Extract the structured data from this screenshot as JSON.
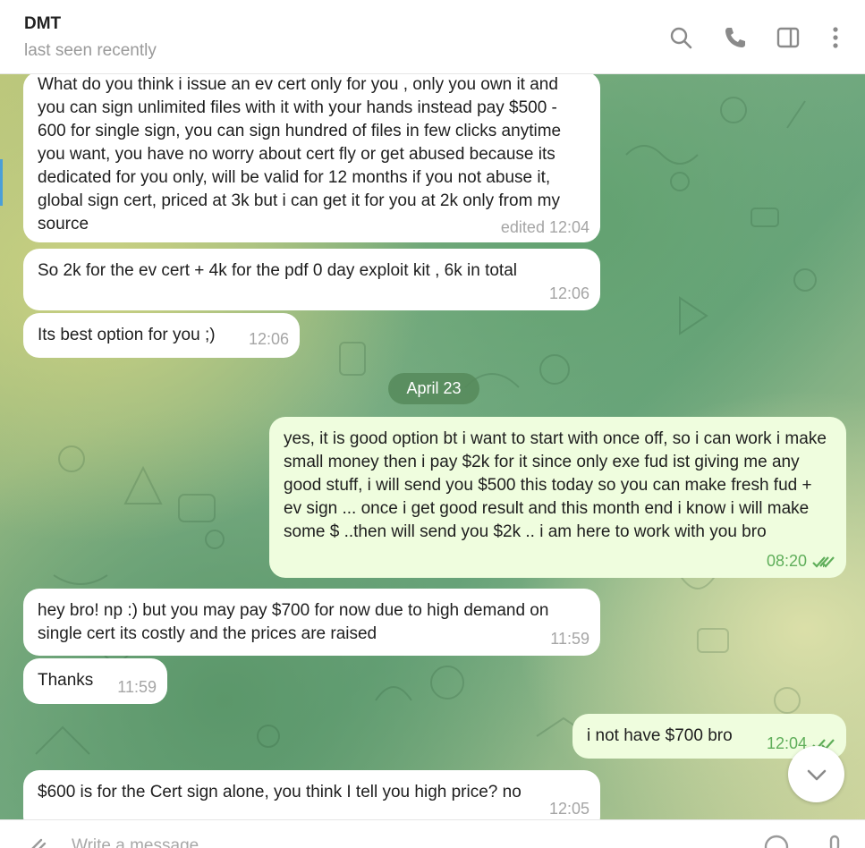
{
  "header": {
    "title": "DMT",
    "status": "last seen recently"
  },
  "date_separator": "April 23",
  "messages": [
    {
      "text": "What do you think i issue an ev cert only for you , only you own it and you can sign unlimited files with it with your hands instead pay $500 - 600 for single sign, you can sign hundred of files in few clicks anytime you want, you have no worry about cert fly or get abused because its dedicated for you only, will be valid for 12 months if you not abuse it, global sign cert, priced at 3k but i can get it for you at 2k only from my source",
      "time": "edited 12:04"
    },
    {
      "text": "So 2k for the ev cert + 4k for the pdf 0 day exploit kit , 6k in total",
      "time": "12:06"
    },
    {
      "text": "Its best option for you ;)",
      "time": "12:06"
    },
    {
      "text": "yes, it is good option bt i want to start with once off, so i can work i make small money then i pay $2k for it since only exe fud ist giving me any good stuff, i will send you $500 this today so you can make fresh fud + ev sign ... once i get good result and this month end i know i will make some $ ..then  will send you $2k .. i am here to work with you bro",
      "time": "08:20"
    },
    {
      "text": "hey bro! np :) but you may pay $700 for now due to high demand on single cert its costly and the prices are raised",
      "time": "11:59"
    },
    {
      "text": "Thanks",
      "time": "11:59"
    },
    {
      "text": "i not have $700 bro",
      "time": "12:04"
    },
    {
      "text": "$600 is for the Cert sign alone, you think I tell you high price? no",
      "time": "12:05"
    }
  ],
  "composer": {
    "placeholder": "Write a message..."
  },
  "icons": {
    "search": "search-icon",
    "call": "phone-icon",
    "sidebar": "sidebar-toggle-icon",
    "more": "more-vertical-icon",
    "scroll": "chevron-down-icon",
    "attach": "paperclip-icon",
    "emoji": "emoji-icon",
    "voice": "microphone-icon",
    "read": "double-check-icon"
  },
  "colors": {
    "incoming_bubble": "#ffffff",
    "outgoing_bubble": "#effdde",
    "outgoing_meta": "#5fae5a",
    "date_pill": "#568a5a"
  }
}
